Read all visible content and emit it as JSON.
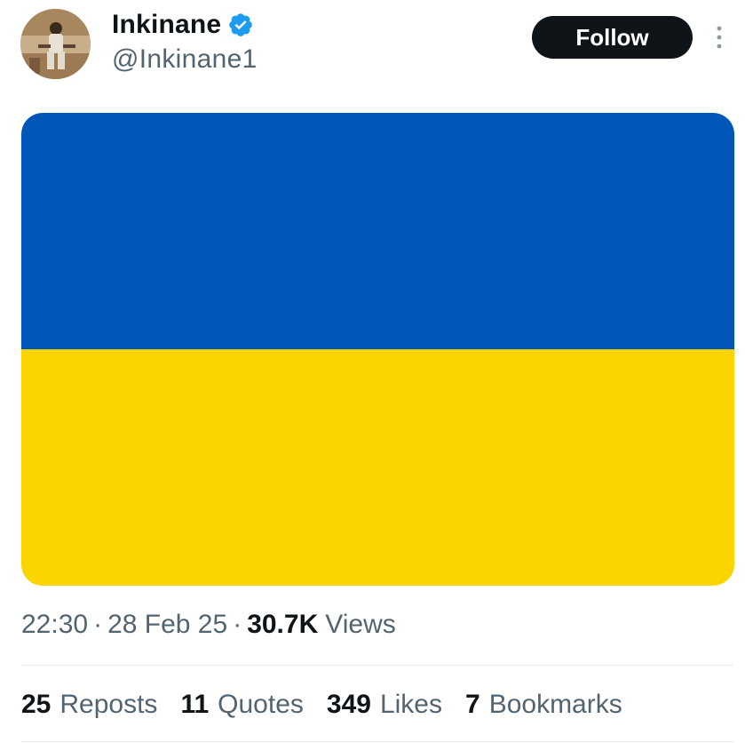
{
  "user": {
    "display_name": "Inkinane",
    "handle": "@Inkinane1",
    "verified": true
  },
  "actions": {
    "follow_label": "Follow"
  },
  "media": {
    "description_colors": {
      "top": "#0057b7",
      "bottom": "#fcd500"
    }
  },
  "meta": {
    "time": "22:30",
    "separator": "·",
    "date": "28 Feb 25",
    "views_count": "30.7K",
    "views_label": "Views"
  },
  "stats": [
    {
      "count": "25",
      "label": "Reposts"
    },
    {
      "count": "11",
      "label": "Quotes"
    },
    {
      "count": "349",
      "label": "Likes"
    },
    {
      "count": "7",
      "label": "Bookmarks"
    }
  ],
  "colors": {
    "text_primary": "#0f1419",
    "text_secondary": "#536471",
    "verified_blue": "#1d9bf0",
    "divider": "#e5e9ec",
    "follow_bg": "#0f1419"
  },
  "icons": {
    "verified": "verified-badge-icon",
    "more": "more-options-icon"
  }
}
